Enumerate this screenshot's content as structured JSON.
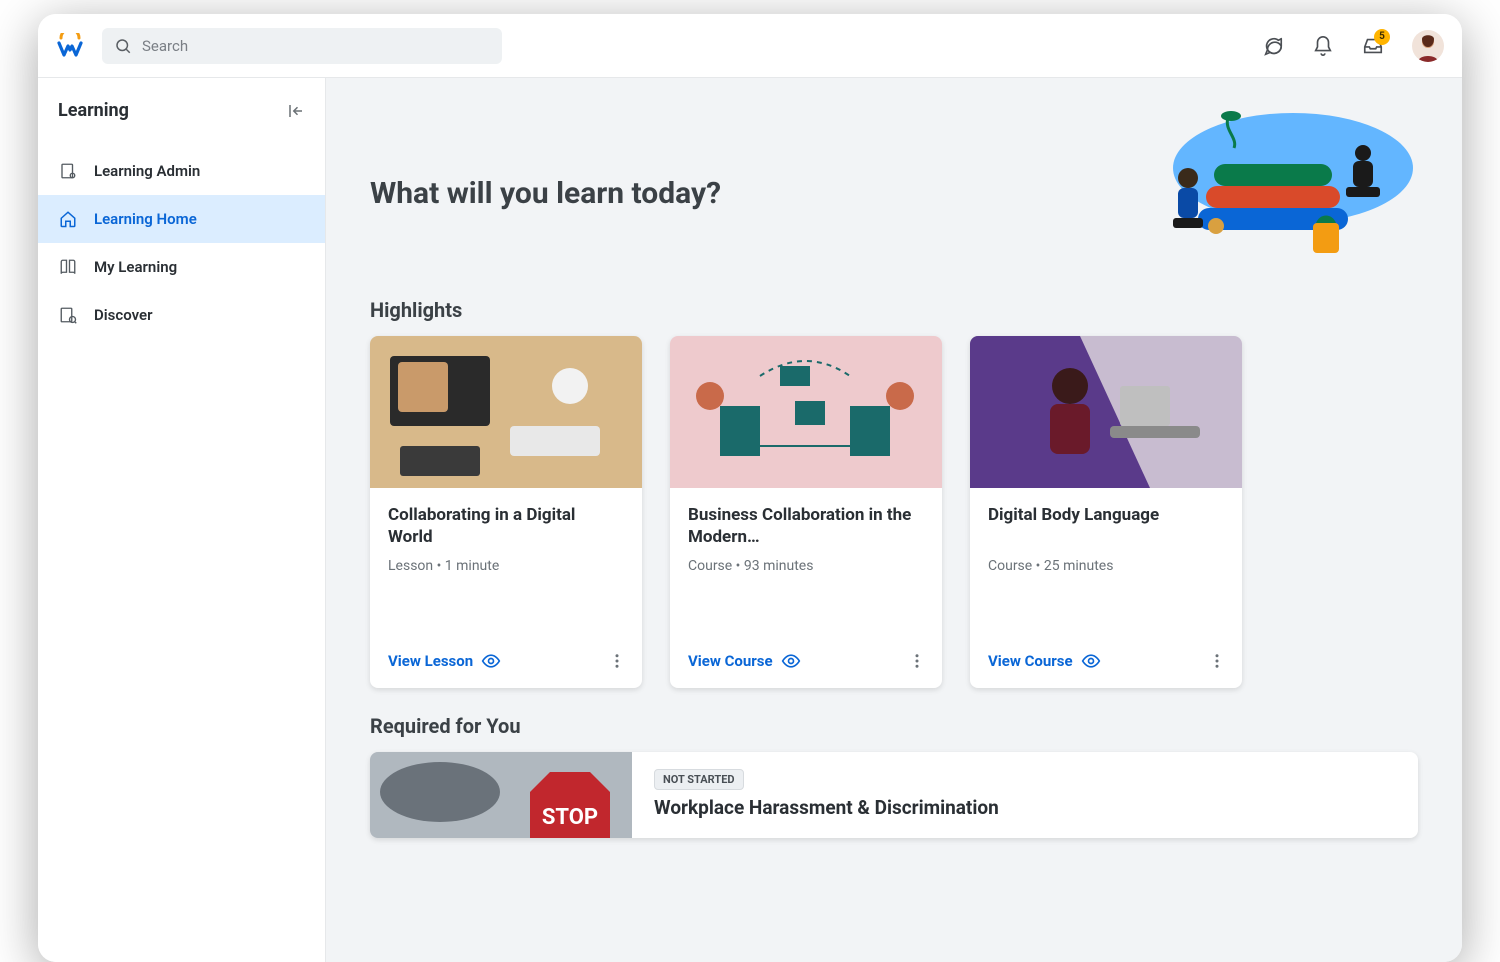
{
  "search": {
    "placeholder": "Search"
  },
  "inbox": {
    "count": "5"
  },
  "sidebar": {
    "title": "Learning",
    "items": [
      {
        "label": "Learning Admin"
      },
      {
        "label": "Learning Home"
      },
      {
        "label": "My Learning"
      },
      {
        "label": "Discover"
      }
    ]
  },
  "hero": {
    "title": "What will you learn today?"
  },
  "sections": {
    "highlights": "Highlights",
    "required": "Required for You"
  },
  "cards": [
    {
      "title": "Collaborating in a Digital World",
      "meta": "Lesson  •  1 minute",
      "action": "View Lesson"
    },
    {
      "title": "Business Collaboration in the Modern…",
      "meta": "Course  •  93 minutes",
      "action": "View Course"
    },
    {
      "title": "Digital Body Language",
      "meta": "Course  •  25 minutes",
      "action": "View Course"
    }
  ],
  "required": {
    "status": "NOT STARTED",
    "title": "Workplace Harassment & Discrimination"
  }
}
